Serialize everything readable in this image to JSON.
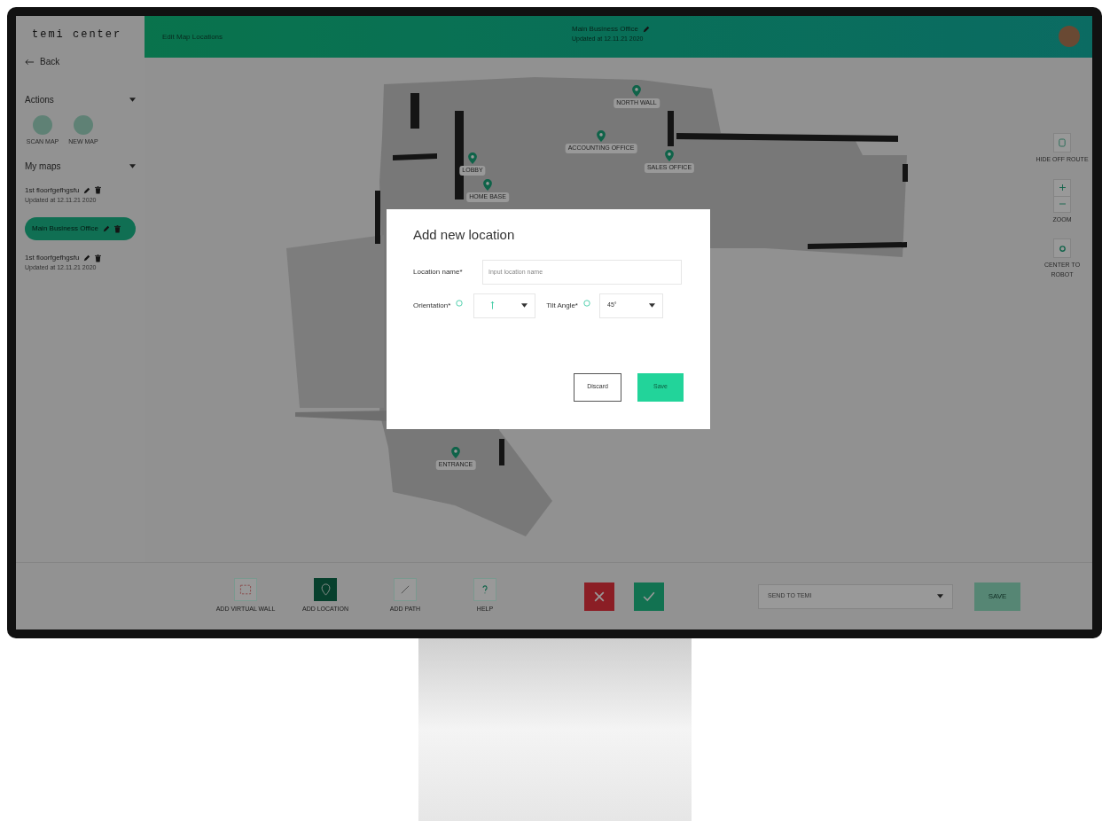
{
  "app": {
    "logo": "temi center",
    "back": "Back"
  },
  "sidebar": {
    "sections": [
      {
        "kind": "actions",
        "title": "Actions",
        "expanded": true,
        "items": [
          {
            "label": "SCAN MAP"
          },
          {
            "label": "NEW MAP"
          }
        ]
      },
      {
        "kind": "maps",
        "title": "My maps",
        "expanded": true,
        "items": [
          {
            "name": "1st floorfgefhgsfu",
            "updated": "Updated at 12.11.21 2020",
            "selected": false
          },
          {
            "name": "Main Business Office",
            "selected": true
          },
          {
            "name": "1st floorfgefhgsfu",
            "updated": "Updated at 12.11.21 2020",
            "selected": false
          }
        ]
      }
    ]
  },
  "header": {
    "left_text": "Edit Map Locations",
    "map_name": "Main Business Office",
    "updated": "Updated at 12.11.21 2020"
  },
  "map": {
    "locations": [
      {
        "label": "NORTH WALL"
      },
      {
        "label": "ACCOUNTING OFFICE"
      },
      {
        "label": "SALES OFFICE"
      },
      {
        "label": "LOBBY"
      },
      {
        "label": "HOME BASE"
      },
      {
        "label": "ENTRANCE"
      }
    ]
  },
  "map_controls": [
    {
      "kind": "toggle",
      "label": "HIDE OFF ROUTE"
    },
    {
      "kind": "zoom",
      "label": "ZOOM"
    },
    {
      "kind": "center",
      "label": "CENTER TO ROBOT"
    }
  ],
  "toolbar": {
    "tools": [
      {
        "kind": "wall",
        "label": "ADD VIRTUAL WALL",
        "selected": false
      },
      {
        "kind": "location",
        "label": "ADD LOCATION",
        "selected": true
      },
      {
        "kind": "path",
        "label": "ADD PATH",
        "selected": false
      },
      {
        "kind": "help",
        "label": "HELP",
        "selected": false
      }
    ],
    "send": {
      "placeholder": "SEND TO TEMI"
    },
    "save": "SAVE"
  },
  "dialog": {
    "title": "Add new location",
    "fields": [
      {
        "label": "Location name*",
        "placeholder": "Input location name"
      }
    ],
    "orientation_label": "Orientation*",
    "tilt_label": "Tilt Angle*",
    "tilt_value": "45°",
    "discard": "Discard",
    "save": "Save"
  }
}
